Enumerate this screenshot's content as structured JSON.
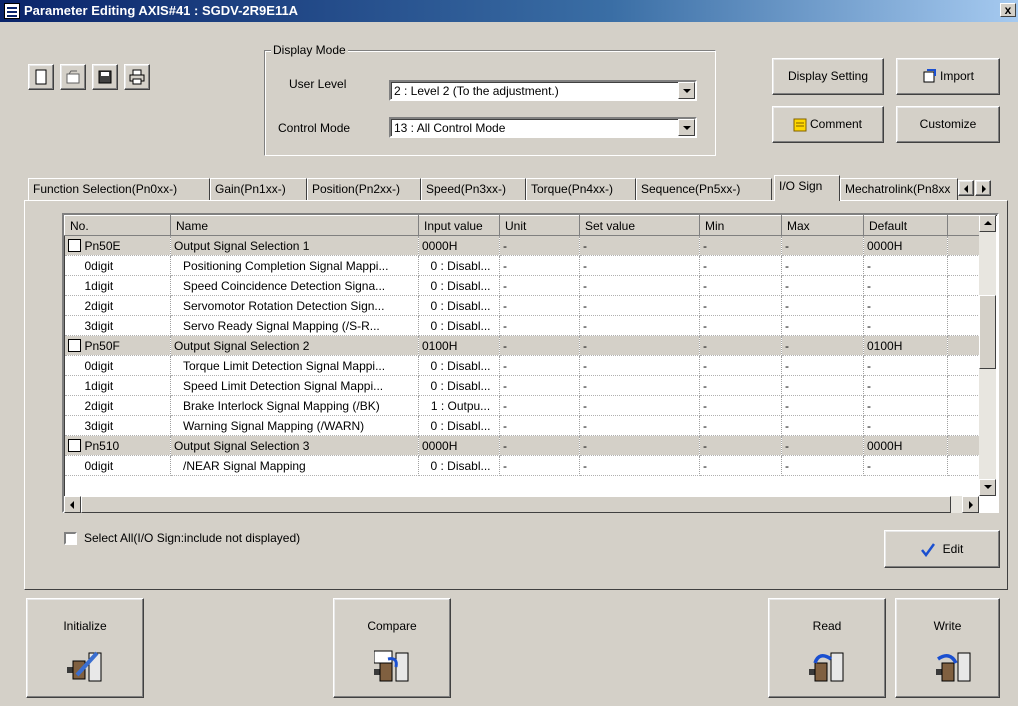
{
  "window": {
    "title": "Parameter Editing  AXIS#41 : SGDV-2R9E11A",
    "close_label": "x"
  },
  "toolbar": {
    "icons": [
      "new-icon",
      "open-icon",
      "save-icon",
      "print-icon"
    ]
  },
  "display_mode": {
    "legend": "Display Mode",
    "user_level_label": "User Level",
    "user_level_value": "2 : Level 2 (To the adjustment.)",
    "control_mode_label": "Control Mode",
    "control_mode_value": "13 : All Control Mode"
  },
  "right_buttons": {
    "display_setting": "Display Setting",
    "import": "Import",
    "comment": "Comment",
    "customize": "Customize"
  },
  "tabs": [
    "Function Selection(Pn0xx-)",
    "Gain(Pn1xx-)",
    "Position(Pn2xx-)",
    "Speed(Pn3xx-)",
    "Torque(Pn4xx-)",
    "Sequence(Pn5xx-)",
    "I/O Sign",
    "Mechatrolink(Pn8xx"
  ],
  "active_tab": "I/O Sign",
  "table": {
    "columns": [
      "No.",
      "Name",
      "Input value",
      "Unit",
      "Set value",
      "Min",
      "Max",
      "Default"
    ],
    "rows": [
      {
        "no": "Pn50E",
        "name": "Output Signal Selection 1",
        "input": "0000H",
        "unit": "-",
        "set": "-",
        "min": "-",
        "max": "-",
        "def": "0000H",
        "kind": "param"
      },
      {
        "no": "0digit",
        "name": "Positioning Completion Signal Mappi...",
        "input": "0 : Disabl...",
        "unit": "-",
        "set": "-",
        "min": "-",
        "max": "-",
        "def": "-",
        "kind": "digit"
      },
      {
        "no": "1digit",
        "name": "Speed Coincidence Detection Signa...",
        "input": "0 : Disabl...",
        "unit": "-",
        "set": "-",
        "min": "-",
        "max": "-",
        "def": "-",
        "kind": "digit"
      },
      {
        "no": "2digit",
        "name": "Servomotor Rotation Detection Sign...",
        "input": "0 : Disabl...",
        "unit": "-",
        "set": "-",
        "min": "-",
        "max": "-",
        "def": "-",
        "kind": "digit"
      },
      {
        "no": "3digit",
        "name": "Servo Ready Signal Mapping (/S-R...",
        "input": "0 : Disabl...",
        "unit": "-",
        "set": "-",
        "min": "-",
        "max": "-",
        "def": "-",
        "kind": "digit"
      },
      {
        "no": "Pn50F",
        "name": "Output Signal Selection 2",
        "input": "0100H",
        "unit": "-",
        "set": "-",
        "min": "-",
        "max": "-",
        "def": "0100H",
        "kind": "param"
      },
      {
        "no": "0digit",
        "name": "Torque Limit Detection Signal Mappi...",
        "input": "0 : Disabl...",
        "unit": "-",
        "set": "-",
        "min": "-",
        "max": "-",
        "def": "-",
        "kind": "digit"
      },
      {
        "no": "1digit",
        "name": "Speed Limit Detection Signal Mappi...",
        "input": "0 : Disabl...",
        "unit": "-",
        "set": "-",
        "min": "-",
        "max": "-",
        "def": "-",
        "kind": "digit"
      },
      {
        "no": "2digit",
        "name": "Brake Interlock Signal Mapping (/BK)",
        "input": "1 : Outpu...",
        "unit": "-",
        "set": "-",
        "min": "-",
        "max": "-",
        "def": "-",
        "kind": "digit"
      },
      {
        "no": "3digit",
        "name": "Warning Signal Mapping (/WARN)",
        "input": "0 : Disabl...",
        "unit": "-",
        "set": "-",
        "min": "-",
        "max": "-",
        "def": "-",
        "kind": "digit"
      },
      {
        "no": "Pn510",
        "name": "Output Signal Selection 3",
        "input": "0000H",
        "unit": "-",
        "set": "-",
        "min": "-",
        "max": "-",
        "def": "0000H",
        "kind": "param"
      },
      {
        "no": "0digit",
        "name": "/NEAR Signal Mapping",
        "input": "0 : Disabl...",
        "unit": "-",
        "set": "-",
        "min": "-",
        "max": "-",
        "def": "-",
        "kind": "digit"
      }
    ]
  },
  "select_all_label": "Select All(I/O Sign:include not displayed)",
  "edit_label": "Edit",
  "bottom_buttons": {
    "initialize": "Initialize",
    "compare": "Compare",
    "read": "Read",
    "write": "Write"
  },
  "colors": {
    "face": "#d4d0c8",
    "title_start": "#0a246a",
    "title_end": "#a6caf0",
    "highlight_row": "#d4d0c8"
  }
}
